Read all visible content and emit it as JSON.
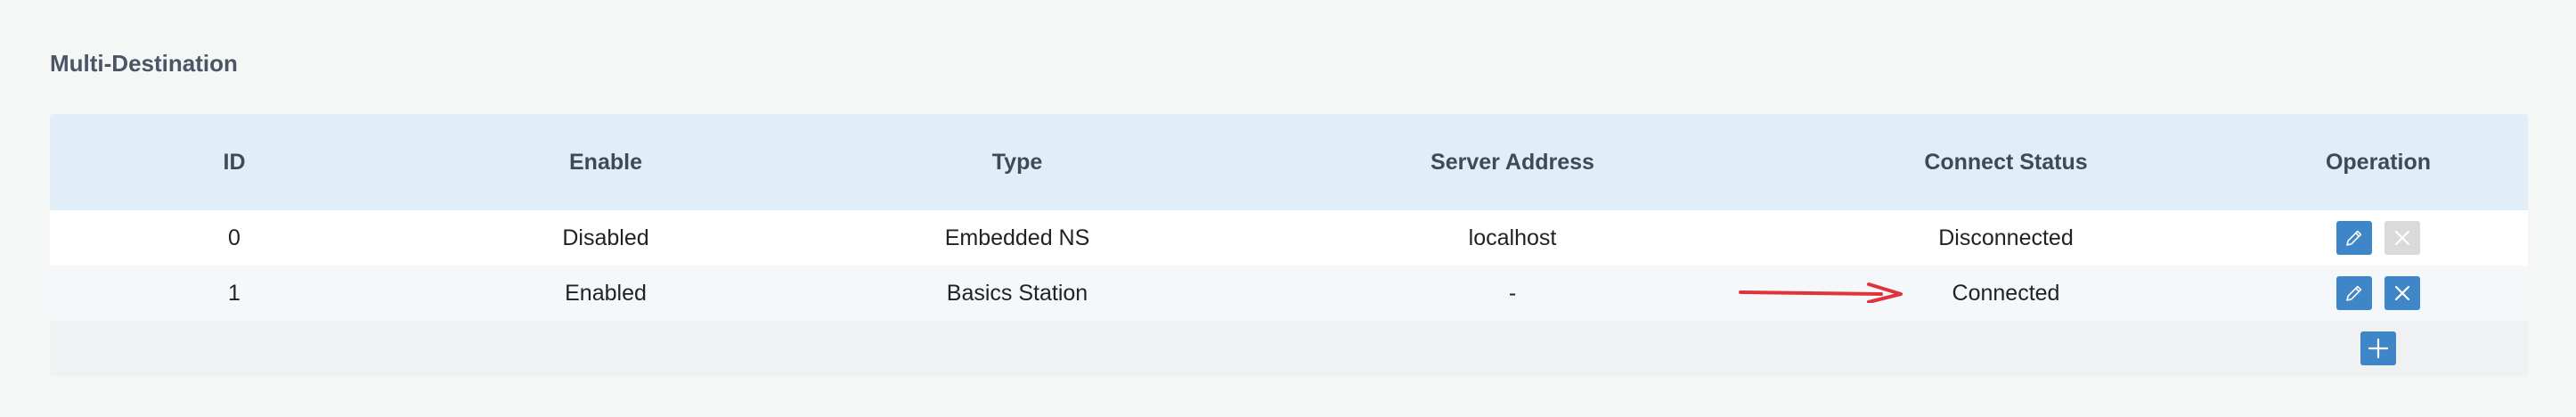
{
  "section": {
    "title": "Multi-Destination"
  },
  "table": {
    "columns": [
      "ID",
      "Enable",
      "Type",
      "Server Address",
      "Connect Status",
      "Operation"
    ],
    "rows": [
      {
        "id": "0",
        "enable": "Disabled",
        "type": "Embedded NS",
        "server": "localhost",
        "status": "Disconnected",
        "delete_enabled": false
      },
      {
        "id": "1",
        "enable": "Enabled",
        "type": "Basics Station",
        "server": "-",
        "status": "Connected",
        "delete_enabled": true
      }
    ]
  },
  "icons": {
    "edit": "pencil-icon",
    "delete": "close-icon",
    "add": "plus-icon",
    "annotation": "red-arrow"
  },
  "colors": {
    "accent": "#3f86c9",
    "header_bg": "#e2eef7",
    "disabled_button": "#d9dadb",
    "arrow": "#e0343c"
  }
}
